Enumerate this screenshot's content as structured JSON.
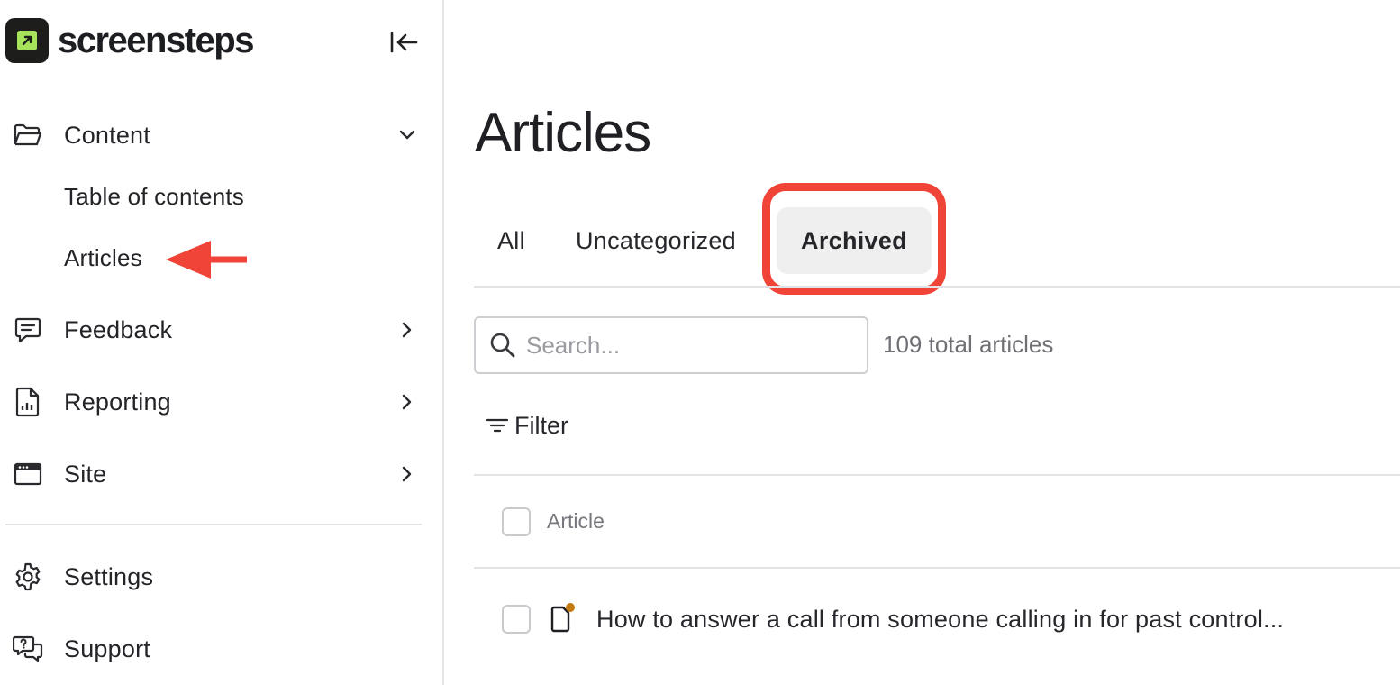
{
  "app": {
    "brand": "screensteps"
  },
  "sidebar": {
    "items": [
      {
        "label": "Content",
        "icon": "folder-open-icon",
        "chevron": "chevron-down-icon"
      },
      {
        "label": "Feedback",
        "icon": "message-square-icon",
        "chevron": "chevron-right-icon"
      },
      {
        "label": "Reporting",
        "icon": "report-document-icon",
        "chevron": "chevron-right-icon"
      },
      {
        "label": "Site",
        "icon": "browser-window-icon",
        "chevron": "chevron-right-icon"
      },
      {
        "label": "Settings",
        "icon": "gear-icon"
      },
      {
        "label": "Support",
        "icon": "support-chat-icon"
      }
    ],
    "content_subitems": [
      {
        "label": "Table of contents"
      },
      {
        "label": "Articles"
      }
    ]
  },
  "main": {
    "title": "Articles",
    "tabs": [
      {
        "label": "All",
        "active": false
      },
      {
        "label": "Uncategorized",
        "active": false
      },
      {
        "label": "Archived",
        "active": true
      }
    ],
    "search": {
      "placeholder": "Search...",
      "value": ""
    },
    "total": "109 total articles",
    "filter_label": "Filter",
    "table": {
      "column_header": "Article",
      "rows": [
        {
          "title": "How to answer a call from someone calling in for past control..."
        }
      ]
    }
  },
  "colors": {
    "accent_red": "#f04438",
    "logo_green": "#a6e35a",
    "status_dot": "#c47a12"
  }
}
